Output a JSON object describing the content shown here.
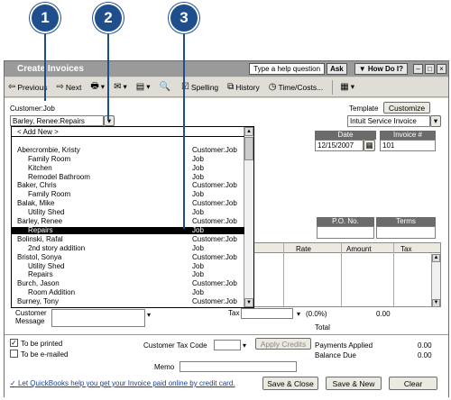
{
  "callouts": [
    "1",
    "2",
    "3"
  ],
  "window": {
    "title": "Create Invoices",
    "help_placeholder": "Type a help question",
    "ask": "Ask",
    "how_do_i": "▼ How Do I?"
  },
  "toolbar": {
    "previous": "Previous",
    "next": "Next",
    "spelling": "Spelling",
    "history": "History",
    "time_costs": "Time/Costs..."
  },
  "form": {
    "customer_job_label": "Customer:Job",
    "customer_job_value": "Barley, Renee:Repairs",
    "template_label": "Template",
    "customize": "Customize",
    "template_value": "Intuit Service Invoice",
    "date_label": "Date",
    "date_value": "12/15/2007",
    "invoice_label": "Invoice #",
    "invoice_value": "101",
    "po_label": "P.O. No.",
    "terms_label": "Terms",
    "col_rate": "Rate",
    "col_amount": "Amount",
    "col_tax": "Tax",
    "customer_message_label_1": "Customer",
    "customer_message_label_2": "Message",
    "tax_label": "Tax",
    "tax_pct": "(0.0%)",
    "tax_amount": "0.00",
    "total_label": "Total",
    "to_be_printed": "To be printed",
    "to_be_emailed": "To be e-mailed",
    "customer_tax_code": "Customer Tax Code",
    "apply_credits": "Apply Credits",
    "payments_applied": "Payments Applied",
    "payments_applied_val": "0.00",
    "balance_due": "Balance Due",
    "balance_due_val": "0.00",
    "memo_label": "Memo",
    "online_link": "Let QuickBooks help you get your Invoice paid online by credit card.",
    "save_close": "Save & Close",
    "save_new": "Save & New",
    "clear": "Clear"
  },
  "dropdown": {
    "rows": [
      {
        "name": "< Add New >",
        "type": "",
        "indent": 0
      },
      {
        "name": "",
        "type": "",
        "indent": 0
      },
      {
        "name": "Abercrombie, Kristy",
        "type": "Customer:Job",
        "indent": 0
      },
      {
        "name": "Family Room",
        "type": "Job",
        "indent": 1
      },
      {
        "name": "Kitchen",
        "type": "Job",
        "indent": 1
      },
      {
        "name": "Remodel Bathroom",
        "type": "Job",
        "indent": 1
      },
      {
        "name": "Baker, Chris",
        "type": "Customer:Job",
        "indent": 0
      },
      {
        "name": "Family Room",
        "type": "Job",
        "indent": 1
      },
      {
        "name": "Balak, Mike",
        "type": "Customer:Job",
        "indent": 0
      },
      {
        "name": "Utility Shed",
        "type": "Job",
        "indent": 1
      },
      {
        "name": "Barley, Renee",
        "type": "Customer:Job",
        "indent": 0
      },
      {
        "name": "Repairs",
        "type": "Job",
        "indent": 1,
        "selected": true
      },
      {
        "name": "Bolinski, Rafal",
        "type": "Customer:Job",
        "indent": 0
      },
      {
        "name": "2nd story addition",
        "type": "Job",
        "indent": 1
      },
      {
        "name": "Bristol, Sonya",
        "type": "Customer:Job",
        "indent": 0
      },
      {
        "name": "Utility Shed",
        "type": "Job",
        "indent": 1
      },
      {
        "name": "Repairs",
        "type": "Job",
        "indent": 1
      },
      {
        "name": "Burch, Jason",
        "type": "Customer:Job",
        "indent": 0
      },
      {
        "name": "Room Addition",
        "type": "Job",
        "indent": 1
      },
      {
        "name": "Burney, Tony",
        "type": "Customer:Job",
        "indent": 0
      }
    ]
  }
}
